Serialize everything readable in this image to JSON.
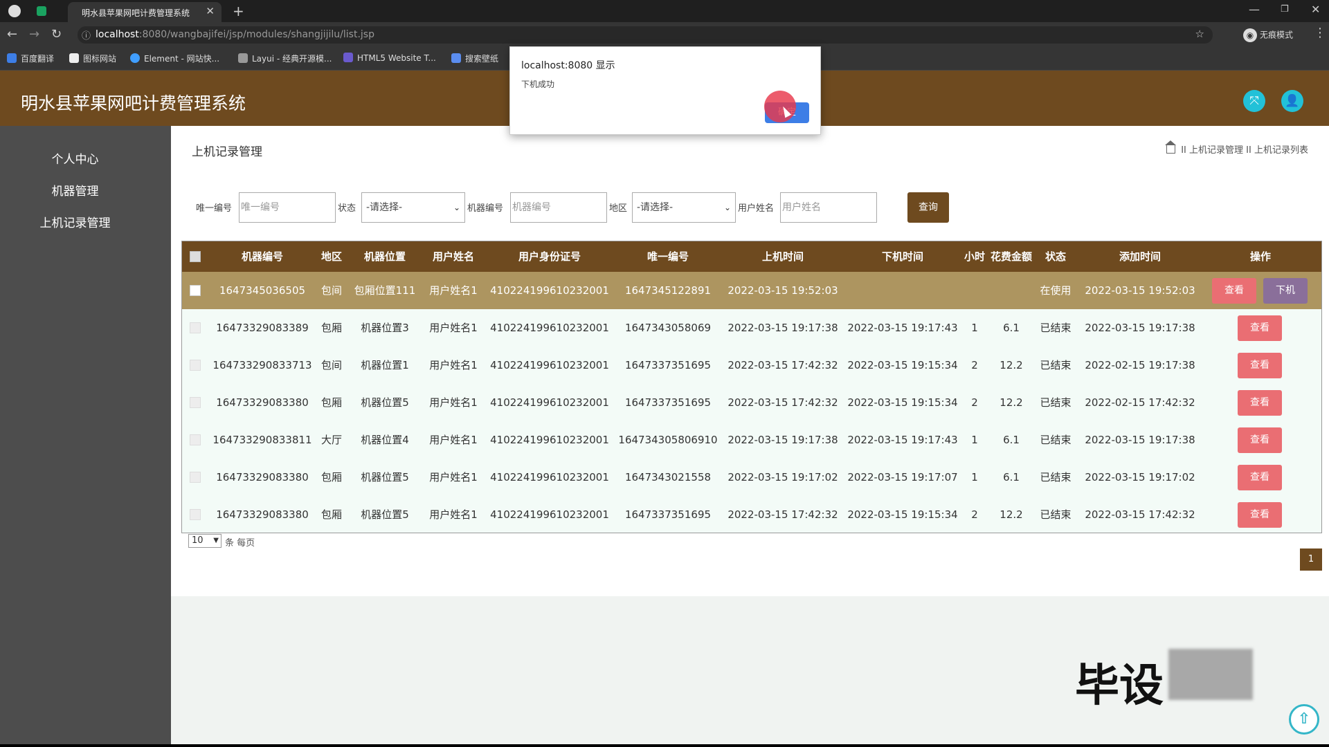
{
  "browser": {
    "tab_title": "明水县苹果网吧计费管理系统",
    "url_host": "localhost",
    "url_path": ":8080/wangbajifei/jsp/modules/shangjijilu/list.jsp",
    "incognito_label": "无痕模式",
    "bookmarks": [
      "百度翻译",
      "图标网站",
      "Element - 网站快...",
      "Layui - 经典开源模...",
      "HTML5 Website T...",
      "搜索壁纸"
    ]
  },
  "app": {
    "title": "明水县苹果网吧计费管理系统"
  },
  "sidebar": {
    "items": [
      "个人中心",
      "机器管理",
      "上机记录管理"
    ]
  },
  "page": {
    "title": "上机记录管理",
    "breadcrumb": [
      "上机记录管理",
      "上机记录列表"
    ],
    "breadcrumb_sep": "II"
  },
  "filters": {
    "uid_label": "唯一编号",
    "uid_placeholder": "唯一编号",
    "status_label": "状态",
    "status_value": "-请选择-",
    "machine_label": "机器编号",
    "machine_placeholder": "机器编号",
    "region_label": "地区",
    "region_value": "-请选择-",
    "user_label": "用户姓名",
    "user_placeholder": "用户姓名",
    "query_button": "查询"
  },
  "table": {
    "headers": [
      "机器编号",
      "地区",
      "机器位置",
      "用户姓名",
      "用户身份证号",
      "唯一编号",
      "上机时间",
      "下机时间",
      "小时",
      "花费金额",
      "状态",
      "添加时间",
      "操作"
    ],
    "view_label": "查看",
    "offline_label": "下机",
    "rows": [
      {
        "machine": "1647345036505",
        "region": "包间",
        "location": "包厢位置111",
        "user": "用户姓名1",
        "idcard": "410224199610232001",
        "uid": "1647345122891",
        "on_time": "2022-03-15 19:52:03",
        "off_time": "",
        "hours": "",
        "cost": "",
        "status": "在使用",
        "added": "2022-03-15 19:52:03"
      },
      {
        "machine": "16473329083389",
        "region": "包厢",
        "location": "机器位置3",
        "user": "用户姓名1",
        "idcard": "410224199610232001",
        "uid": "1647343058069",
        "on_time": "2022-03-15 19:17:38",
        "off_time": "2022-03-15 19:17:43",
        "hours": "1",
        "cost": "6.1",
        "status": "已结束",
        "added": "2022-03-15 19:17:38"
      },
      {
        "machine": "164733290833713",
        "region": "包间",
        "location": "机器位置1",
        "user": "用户姓名1",
        "idcard": "410224199610232001",
        "uid": "1647337351695",
        "on_time": "2022-03-15 17:42:32",
        "off_time": "2022-03-15 19:15:34",
        "hours": "2",
        "cost": "12.2",
        "status": "已结束",
        "added": "2022-02-15 19:17:38"
      },
      {
        "machine": "16473329083380",
        "region": "包厢",
        "location": "机器位置5",
        "user": "用户姓名1",
        "idcard": "410224199610232001",
        "uid": "1647337351695",
        "on_time": "2022-03-15 17:42:32",
        "off_time": "2022-03-15 19:15:34",
        "hours": "2",
        "cost": "12.2",
        "status": "已结束",
        "added": "2022-02-15 17:42:32"
      },
      {
        "machine": "164733290833811",
        "region": "大厅",
        "location": "机器位置4",
        "user": "用户姓名1",
        "idcard": "410224199610232001",
        "uid": "164734305806910",
        "on_time": "2022-03-15 19:17:38",
        "off_time": "2022-03-15 19:17:43",
        "hours": "1",
        "cost": "6.1",
        "status": "已结束",
        "added": "2022-03-15 19:17:38"
      },
      {
        "machine": "16473329083380",
        "region": "包厢",
        "location": "机器位置5",
        "user": "用户姓名1",
        "idcard": "410224199610232001",
        "uid": "1647343021558",
        "on_time": "2022-03-15 19:17:02",
        "off_time": "2022-03-15 19:17:07",
        "hours": "1",
        "cost": "6.1",
        "status": "已结束",
        "added": "2022-03-15 19:17:02"
      },
      {
        "machine": "16473329083380",
        "region": "包厢",
        "location": "机器位置5",
        "user": "用户姓名1",
        "idcard": "410224199610232001",
        "uid": "1647337351695",
        "on_time": "2022-03-15 17:42:32",
        "off_time": "2022-03-15 19:15:34",
        "hours": "2",
        "cost": "12.2",
        "status": "已结束",
        "added": "2022-03-15 17:42:32"
      }
    ]
  },
  "pagination": {
    "page_size": "10",
    "per_page_label": "条 每页",
    "current_page": "1"
  },
  "dialog": {
    "title": "localhost:8080 显示",
    "message": "下机成功",
    "ok_label": "确定"
  },
  "watermark": {
    "text": "毕设"
  },
  "colors": {
    "header_brown": "#6e4a1f",
    "sidebar_gray": "#4d4d4d",
    "active_row": "#ad9560",
    "view_button": "#ea6e73",
    "offline_button": "#8a6f9a",
    "accent_cyan": "#22c1d8"
  }
}
